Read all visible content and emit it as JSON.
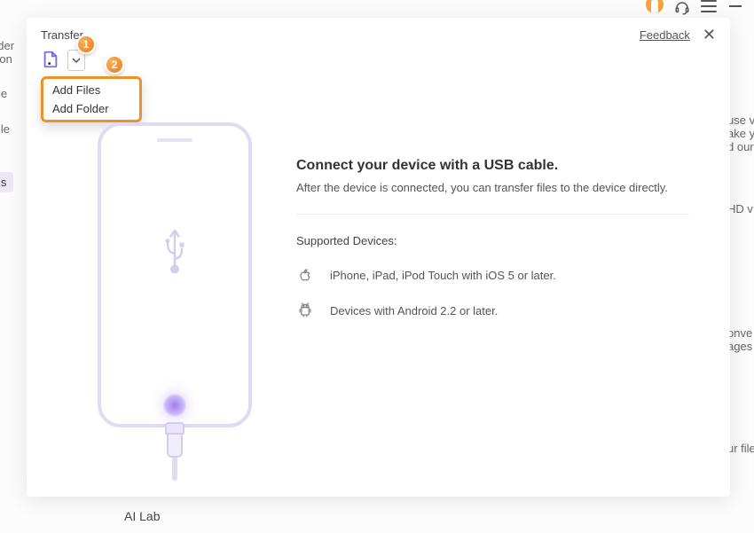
{
  "bg_left": {
    "l1": "nder",
    "l2": "Con",
    "l3": "me",
    "l4": "File",
    "l5": "ls"
  },
  "bg_right": {
    "r1": "use v",
    "r2": "ake y",
    "r3": "d our",
    "r4": "HD v",
    "r5": "onve",
    "r6": "ages",
    "r7": "ur file"
  },
  "bg_bottom": "AI Lab",
  "modal": {
    "title": "Transfer",
    "feedback": "Feedback",
    "toolbar": {
      "dropdown": {
        "add_files": "Add Files",
        "add_folder": "Add Folder"
      },
      "step1": "1",
      "step2": "2"
    },
    "content": {
      "headline": "Connect your device with a USB cable.",
      "subline": "After the device is connected, you can transfer files to the device directly.",
      "supported_label": "Supported Devices:",
      "apple_text": "iPhone, iPad, iPod Touch with iOS 5 or later.",
      "android_text": "Devices with Android 2.2 or later."
    }
  }
}
